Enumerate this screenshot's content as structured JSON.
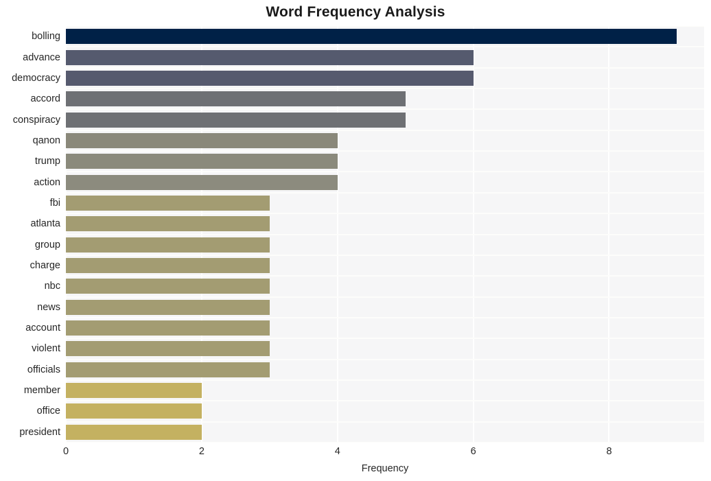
{
  "chart_data": {
    "type": "bar",
    "orientation": "horizontal",
    "title": "Word Frequency Analysis",
    "xlabel": "Frequency",
    "ylabel": "",
    "xlim": [
      0,
      9.4
    ],
    "xticks": [
      0,
      2,
      4,
      6,
      8
    ],
    "xticklabels": [
      "0",
      "2",
      "4",
      "6",
      "8"
    ],
    "grid": true,
    "legend": null,
    "categories": [
      "bolling",
      "advance",
      "democracy",
      "accord",
      "conspiracy",
      "qanon",
      "trump",
      "action",
      "fbi",
      "atlanta",
      "group",
      "charge",
      "nbc",
      "news",
      "account",
      "violent",
      "officials",
      "member",
      "office",
      "president"
    ],
    "values": [
      9,
      6,
      6,
      5,
      5,
      4,
      4,
      4,
      3,
      3,
      3,
      3,
      3,
      3,
      3,
      3,
      3,
      2,
      2,
      2
    ],
    "bar_colors": [
      "#002147",
      "#555a6e",
      "#565a6e",
      "#6e7074",
      "#6e7074",
      "#8a887a",
      "#8b8a7c",
      "#8c8b7e",
      "#a39c72",
      "#a39c72",
      "#a39c72",
      "#a39c72",
      "#a39c72",
      "#a39c72",
      "#a39c72",
      "#a39c72",
      "#a39c72",
      "#c4b161",
      "#c4b161",
      "#c4b161"
    ],
    "plot_background": "#f6f6f7",
    "gridline_color": "#ffffff"
  }
}
